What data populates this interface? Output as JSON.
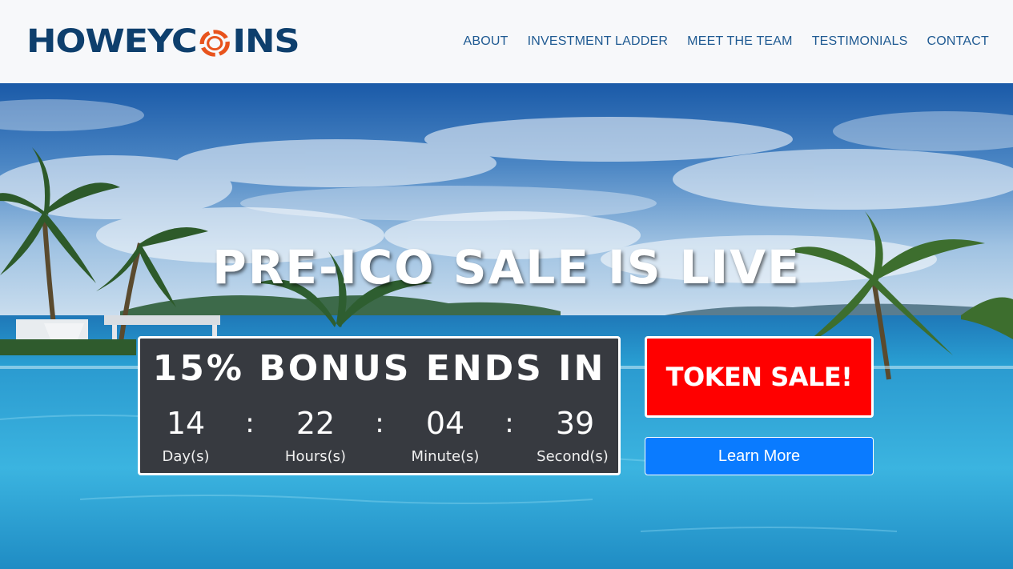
{
  "brand": {
    "logo_before": "HOWEYC",
    "logo_after": "INS",
    "logo_icon": "coin-ring-icon",
    "logo_color": "#0e3f6d",
    "logo_accent": "#e8531c"
  },
  "nav": {
    "items": [
      {
        "label": "ABOUT"
      },
      {
        "label": "INVESTMENT LADDER"
      },
      {
        "label": "MEET THE TEAM"
      },
      {
        "label": "TESTIMONIALS"
      },
      {
        "label": "CONTACT"
      }
    ],
    "color": "#1f5a92"
  },
  "hero": {
    "headline": "PRE-ICO SALE IS LIVE",
    "background_scene": "tropical-pool-ocean-palms"
  },
  "countdown": {
    "title": "15% BONUS ENDS IN",
    "units": [
      {
        "value": "14",
        "label": "Day(s)"
      },
      {
        "value": "22",
        "label": "Hours(s)"
      },
      {
        "value": "04",
        "label": "Minute(s)"
      },
      {
        "value": "39",
        "label": "Second(s)"
      }
    ],
    "separator": ":",
    "background": "#373a40"
  },
  "cta": {
    "token_sale_label": "TOKEN SALE!",
    "token_sale_color": "#ff0000",
    "learn_more_label": "Learn More",
    "learn_more_color": "#0a7bff"
  }
}
